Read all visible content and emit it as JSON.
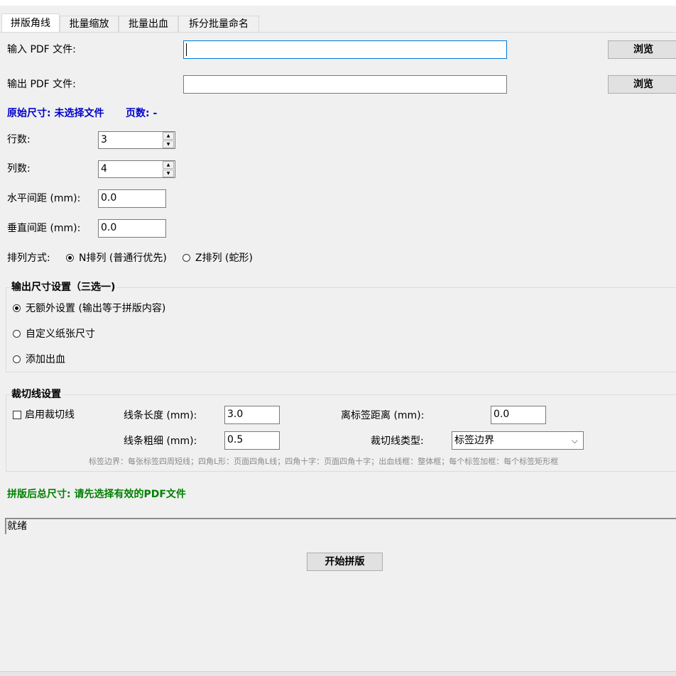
{
  "tabs": [
    {
      "label": "拼版角线",
      "active": true
    },
    {
      "label": "批量缩放",
      "active": false
    },
    {
      "label": "批量出血",
      "active": false
    },
    {
      "label": "拆分批量命名",
      "active": false
    }
  ],
  "input_pdf": {
    "label": "输入 PDF 文件:",
    "value": "",
    "browse_label": "浏览"
  },
  "output_pdf": {
    "label": "输出 PDF 文件:",
    "value": "",
    "browse_label": "浏览"
  },
  "info": {
    "original_size": "原始尺寸: 未选择文件",
    "pages": "页数: -",
    "color": "#0000cc"
  },
  "rows": {
    "label": "行数:",
    "value": "3"
  },
  "cols": {
    "label": "列数:",
    "value": "4"
  },
  "h_gap": {
    "label": "水平间距 (mm):",
    "value": "0.0"
  },
  "v_gap": {
    "label": "垂直间距 (mm):",
    "value": "0.0"
  },
  "arrangement": {
    "label": "排列方式:",
    "options": [
      {
        "label": "N排列 (普通行优先)",
        "selected": true
      },
      {
        "label": "Z排列 (蛇形)",
        "selected": false
      }
    ]
  },
  "output_size": {
    "title": "输出尺寸设置（三选一)",
    "options": [
      {
        "label": "无额外设置 (输出等于拼版内容)",
        "selected": true
      },
      {
        "label": "自定义纸张尺寸",
        "selected": false
      },
      {
        "label": "添加出血",
        "selected": false
      }
    ]
  },
  "cut_lines": {
    "title": "裁切线设置",
    "enable_label": "启用裁切线",
    "enabled": false,
    "line_length": {
      "label": "线条长度 (mm):",
      "value": "3.0"
    },
    "line_width": {
      "label": "线条粗细 (mm):",
      "value": "0.5"
    },
    "label_distance": {
      "label": "离标签距离 (mm):",
      "value": "0.0"
    },
    "line_type": {
      "label": "裁切线类型:",
      "value": "标签边界"
    },
    "hint": "标签边界：每张标签四周短线；四角L形：页面四角L线；四角十字：页面四角十字；出血线框：整体框；每个标签加框：每个标签矩形框"
  },
  "total_size": {
    "text": "拼版后总尺寸: 请先选择有效的PDF文件",
    "color": "#008000"
  },
  "status": {
    "text": "就绪"
  },
  "start_button": {
    "label": "开始拼版"
  }
}
